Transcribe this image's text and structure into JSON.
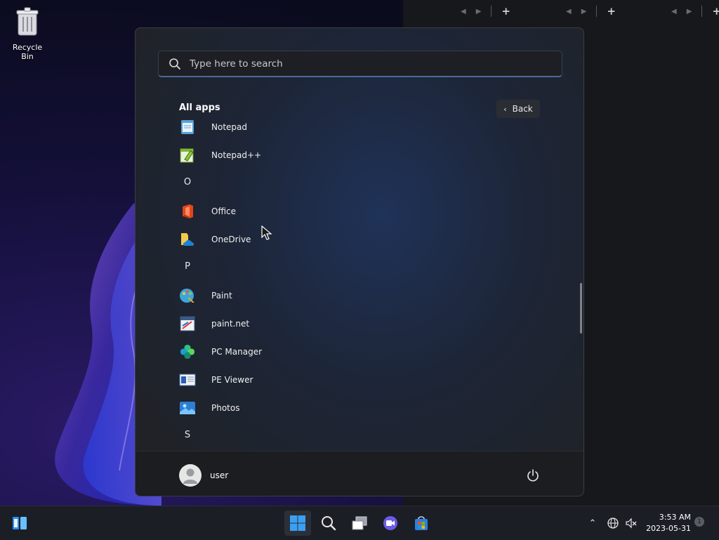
{
  "desktop": {
    "recycle_bin_label": "Recycle Bin"
  },
  "start_menu": {
    "search_placeholder": "Type here to search",
    "all_apps_title": "All apps",
    "back_label": "Back",
    "sections": [
      {
        "type": "app",
        "label": "Notepad",
        "icon": "notepad-icon"
      },
      {
        "type": "app",
        "label": "Notepad++",
        "icon": "notepadpp-icon"
      },
      {
        "type": "letter",
        "label": "O"
      },
      {
        "type": "app",
        "label": "Office",
        "icon": "office-icon"
      },
      {
        "type": "app",
        "label": "OneDrive",
        "icon": "onedrive-icon"
      },
      {
        "type": "letter",
        "label": "P"
      },
      {
        "type": "app",
        "label": "Paint",
        "icon": "paint-icon"
      },
      {
        "type": "app",
        "label": "paint.net",
        "icon": "paintnet-icon"
      },
      {
        "type": "app",
        "label": "PC Manager",
        "icon": "pc-manager-icon"
      },
      {
        "type": "app",
        "label": "PE Viewer",
        "icon": "pe-viewer-icon"
      },
      {
        "type": "app",
        "label": "Photos",
        "icon": "photos-icon"
      },
      {
        "type": "letter",
        "label": "S"
      }
    ],
    "user_name": "user"
  },
  "taskbar": {
    "time": "3:53 AM",
    "date": "2023-05-31",
    "notification_count": "1"
  },
  "colors": {
    "accent": "#4a6b9a",
    "start_bg": "#202226",
    "taskbar_bg": "#1c1e26"
  }
}
